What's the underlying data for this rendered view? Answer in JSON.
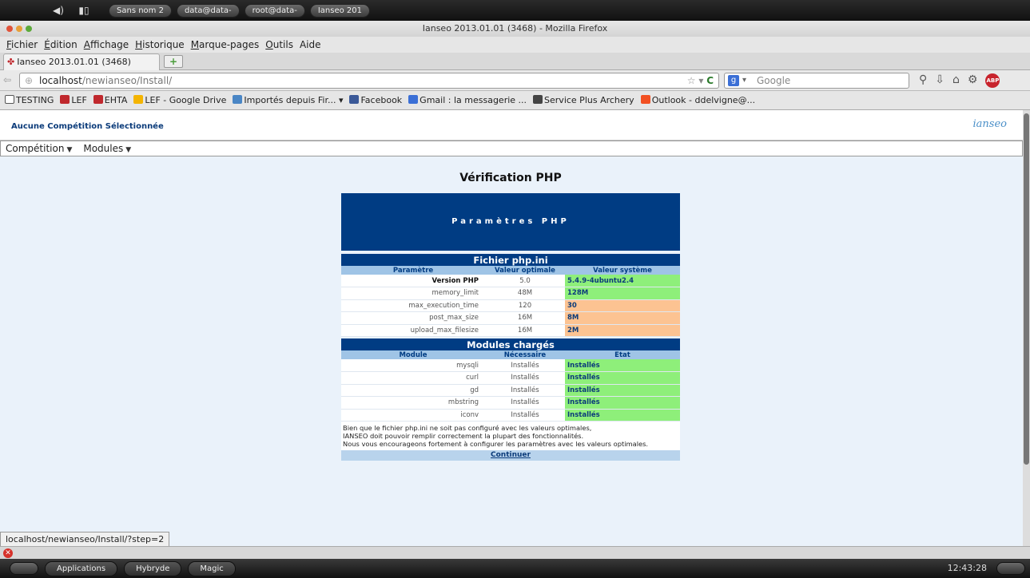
{
  "system_panel": {
    "tasks": [
      "Sans nom 2",
      "data@data-",
      "root@data-",
      "Ianseo 201"
    ]
  },
  "window": {
    "title": "Ianseo 2013.01.01 (3468) - Mozilla Firefox"
  },
  "menubar": {
    "items": [
      {
        "key": "F",
        "rest": "ichier"
      },
      {
        "key": "É",
        "rest": "dition"
      },
      {
        "key": "A",
        "rest": "ffichage"
      },
      {
        "key": "H",
        "rest": "istorique"
      },
      {
        "key": "M",
        "rest": "arque-pages"
      },
      {
        "key": "O",
        "rest": "utils"
      },
      {
        "key": "",
        "rest": "Aide"
      }
    ]
  },
  "tab": {
    "label": "Ianseo 2013.01.01 (3468)",
    "newtab": "+"
  },
  "urlbar": {
    "host": "localhost",
    "path": "/newianseo/Install/"
  },
  "searchbar": {
    "placeholder": "Google"
  },
  "bookmarks": [
    {
      "label": "TESTING",
      "icon": "checkbox-icon",
      "color": "#ffffff"
    },
    {
      "label": "LEF",
      "icon": "ianseo-icon",
      "color": "#c0282d"
    },
    {
      "label": "EHTA",
      "icon": "ianseo-icon",
      "color": "#c0282d"
    },
    {
      "label": "LEF - Google Drive",
      "icon": "drive-icon",
      "color": "#f4b400"
    },
    {
      "label": "Importés depuis Fir... ▾",
      "icon": "folder-icon",
      "color": "#4a86c5"
    },
    {
      "label": "Facebook",
      "icon": "facebook-icon",
      "color": "#3b5998"
    },
    {
      "label": "Gmail : la messagerie ...",
      "icon": "gmail-icon",
      "color": "#3b6fd6"
    },
    {
      "label": "Service Plus Archery",
      "icon": "archery-icon",
      "color": "#444444"
    },
    {
      "label": "Outlook - ddelvigne@...",
      "icon": "outlook-icon",
      "color": "#f25022"
    }
  ],
  "app": {
    "competition_title": "Aucune Compétition Sélectionnée",
    "logo": "ianseo",
    "menu": [
      "Compétition",
      "Modules"
    ]
  },
  "page": {
    "title": "Vérification PHP",
    "header": "Paramètres PHP"
  },
  "ini_section": {
    "title": "Fichier php.ini",
    "columns": [
      "Paramètre",
      "Valeur optimale",
      "Valeur système"
    ],
    "rows": [
      {
        "name": "Version PHP",
        "optimal": "5.0",
        "system": "5.4.9-4ubuntu2.4",
        "status": "ok",
        "strong": true
      },
      {
        "name": "memory_limit",
        "optimal": "48M",
        "system": "128M",
        "status": "ok",
        "strong": false
      },
      {
        "name": "max_execution_time",
        "optimal": "120",
        "system": "30",
        "status": "warn",
        "strong": false
      },
      {
        "name": "post_max_size",
        "optimal": "16M",
        "system": "8M",
        "status": "warn",
        "strong": false
      },
      {
        "name": "upload_max_filesize",
        "optimal": "16M",
        "system": "2M",
        "status": "warn",
        "strong": false
      }
    ]
  },
  "modules_section": {
    "title": "Modules chargés",
    "columns": [
      "Module",
      "Nécessaire",
      "Etat"
    ],
    "rows": [
      {
        "name": "mysqli",
        "required": "Installés",
        "state": "Installés"
      },
      {
        "name": "curl",
        "required": "Installés",
        "state": "Installés"
      },
      {
        "name": "gd",
        "required": "Installés",
        "state": "Installés"
      },
      {
        "name": "mbstring",
        "required": "Installés",
        "state": "Installés"
      },
      {
        "name": "iconv",
        "required": "Installés",
        "state": "Installés"
      }
    ]
  },
  "notes": [
    "Bien que le fichier php.ini ne soit pas configuré avec les valeurs optimales,",
    "IANSEO doit pouvoir remplir correctement la plupart des fonctionnalités.",
    "Nous vous encourageons fortement à configurer les paramètres avec les valeurs optimales."
  ],
  "continue_label": "Continuer",
  "status_url": "localhost/newianseo/Install/?step=2",
  "taskbar": {
    "buttons": [
      "Applications",
      "Hybryde",
      "Magic"
    ],
    "clock": "12:43:28"
  },
  "colors": {
    "header_blue": "#003c83",
    "ok_green": "#8eef7a",
    "warn_orange": "#fcc392",
    "page_bg": "#eaf2fa"
  }
}
